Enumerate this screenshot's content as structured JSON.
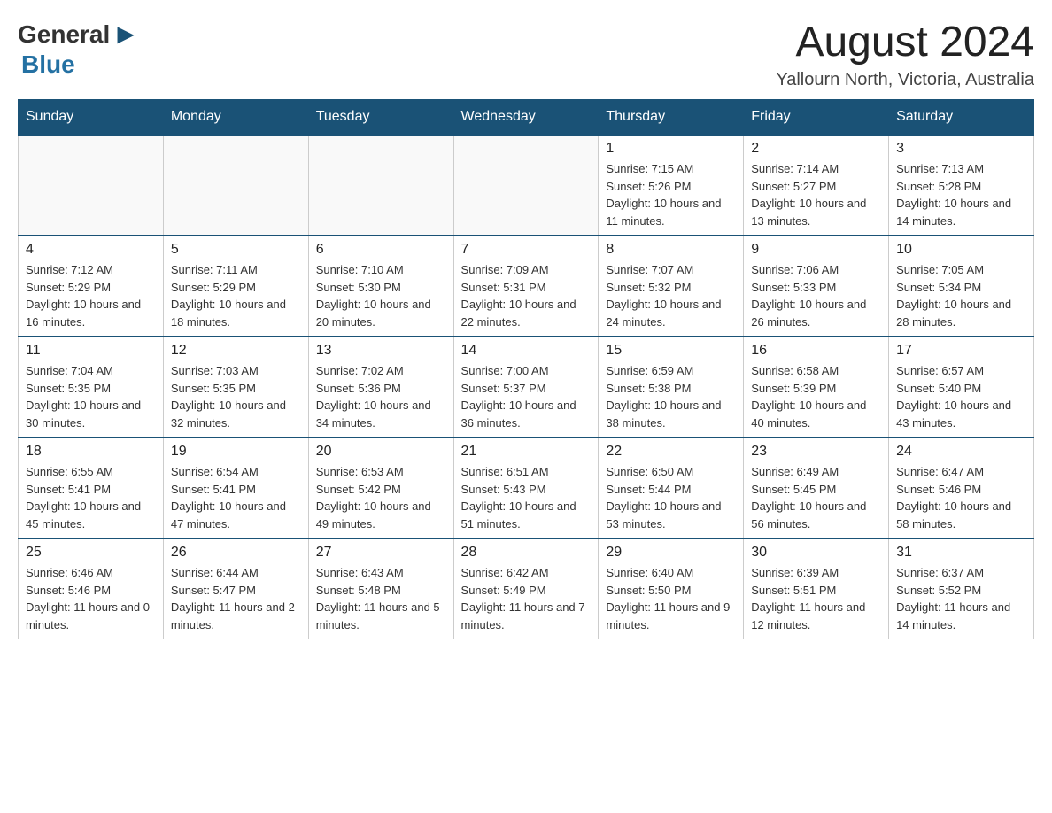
{
  "header": {
    "logo_general": "General",
    "logo_blue": "Blue",
    "month": "August 2024",
    "location": "Yallourn North, Victoria, Australia"
  },
  "weekdays": [
    "Sunday",
    "Monday",
    "Tuesday",
    "Wednesday",
    "Thursday",
    "Friday",
    "Saturday"
  ],
  "weeks": [
    [
      {
        "day": "",
        "info": ""
      },
      {
        "day": "",
        "info": ""
      },
      {
        "day": "",
        "info": ""
      },
      {
        "day": "",
        "info": ""
      },
      {
        "day": "1",
        "info": "Sunrise: 7:15 AM\nSunset: 5:26 PM\nDaylight: 10 hours and 11 minutes."
      },
      {
        "day": "2",
        "info": "Sunrise: 7:14 AM\nSunset: 5:27 PM\nDaylight: 10 hours and 13 minutes."
      },
      {
        "day": "3",
        "info": "Sunrise: 7:13 AM\nSunset: 5:28 PM\nDaylight: 10 hours and 14 minutes."
      }
    ],
    [
      {
        "day": "4",
        "info": "Sunrise: 7:12 AM\nSunset: 5:29 PM\nDaylight: 10 hours and 16 minutes."
      },
      {
        "day": "5",
        "info": "Sunrise: 7:11 AM\nSunset: 5:29 PM\nDaylight: 10 hours and 18 minutes."
      },
      {
        "day": "6",
        "info": "Sunrise: 7:10 AM\nSunset: 5:30 PM\nDaylight: 10 hours and 20 minutes."
      },
      {
        "day": "7",
        "info": "Sunrise: 7:09 AM\nSunset: 5:31 PM\nDaylight: 10 hours and 22 minutes."
      },
      {
        "day": "8",
        "info": "Sunrise: 7:07 AM\nSunset: 5:32 PM\nDaylight: 10 hours and 24 minutes."
      },
      {
        "day": "9",
        "info": "Sunrise: 7:06 AM\nSunset: 5:33 PM\nDaylight: 10 hours and 26 minutes."
      },
      {
        "day": "10",
        "info": "Sunrise: 7:05 AM\nSunset: 5:34 PM\nDaylight: 10 hours and 28 minutes."
      }
    ],
    [
      {
        "day": "11",
        "info": "Sunrise: 7:04 AM\nSunset: 5:35 PM\nDaylight: 10 hours and 30 minutes."
      },
      {
        "day": "12",
        "info": "Sunrise: 7:03 AM\nSunset: 5:35 PM\nDaylight: 10 hours and 32 minutes."
      },
      {
        "day": "13",
        "info": "Sunrise: 7:02 AM\nSunset: 5:36 PM\nDaylight: 10 hours and 34 minutes."
      },
      {
        "day": "14",
        "info": "Sunrise: 7:00 AM\nSunset: 5:37 PM\nDaylight: 10 hours and 36 minutes."
      },
      {
        "day": "15",
        "info": "Sunrise: 6:59 AM\nSunset: 5:38 PM\nDaylight: 10 hours and 38 minutes."
      },
      {
        "day": "16",
        "info": "Sunrise: 6:58 AM\nSunset: 5:39 PM\nDaylight: 10 hours and 40 minutes."
      },
      {
        "day": "17",
        "info": "Sunrise: 6:57 AM\nSunset: 5:40 PM\nDaylight: 10 hours and 43 minutes."
      }
    ],
    [
      {
        "day": "18",
        "info": "Sunrise: 6:55 AM\nSunset: 5:41 PM\nDaylight: 10 hours and 45 minutes."
      },
      {
        "day": "19",
        "info": "Sunrise: 6:54 AM\nSunset: 5:41 PM\nDaylight: 10 hours and 47 minutes."
      },
      {
        "day": "20",
        "info": "Sunrise: 6:53 AM\nSunset: 5:42 PM\nDaylight: 10 hours and 49 minutes."
      },
      {
        "day": "21",
        "info": "Sunrise: 6:51 AM\nSunset: 5:43 PM\nDaylight: 10 hours and 51 minutes."
      },
      {
        "day": "22",
        "info": "Sunrise: 6:50 AM\nSunset: 5:44 PM\nDaylight: 10 hours and 53 minutes."
      },
      {
        "day": "23",
        "info": "Sunrise: 6:49 AM\nSunset: 5:45 PM\nDaylight: 10 hours and 56 minutes."
      },
      {
        "day": "24",
        "info": "Sunrise: 6:47 AM\nSunset: 5:46 PM\nDaylight: 10 hours and 58 minutes."
      }
    ],
    [
      {
        "day": "25",
        "info": "Sunrise: 6:46 AM\nSunset: 5:46 PM\nDaylight: 11 hours and 0 minutes."
      },
      {
        "day": "26",
        "info": "Sunrise: 6:44 AM\nSunset: 5:47 PM\nDaylight: 11 hours and 2 minutes."
      },
      {
        "day": "27",
        "info": "Sunrise: 6:43 AM\nSunset: 5:48 PM\nDaylight: 11 hours and 5 minutes."
      },
      {
        "day": "28",
        "info": "Sunrise: 6:42 AM\nSunset: 5:49 PM\nDaylight: 11 hours and 7 minutes."
      },
      {
        "day": "29",
        "info": "Sunrise: 6:40 AM\nSunset: 5:50 PM\nDaylight: 11 hours and 9 minutes."
      },
      {
        "day": "30",
        "info": "Sunrise: 6:39 AM\nSunset: 5:51 PM\nDaylight: 11 hours and 12 minutes."
      },
      {
        "day": "31",
        "info": "Sunrise: 6:37 AM\nSunset: 5:52 PM\nDaylight: 11 hours and 14 minutes."
      }
    ]
  ]
}
